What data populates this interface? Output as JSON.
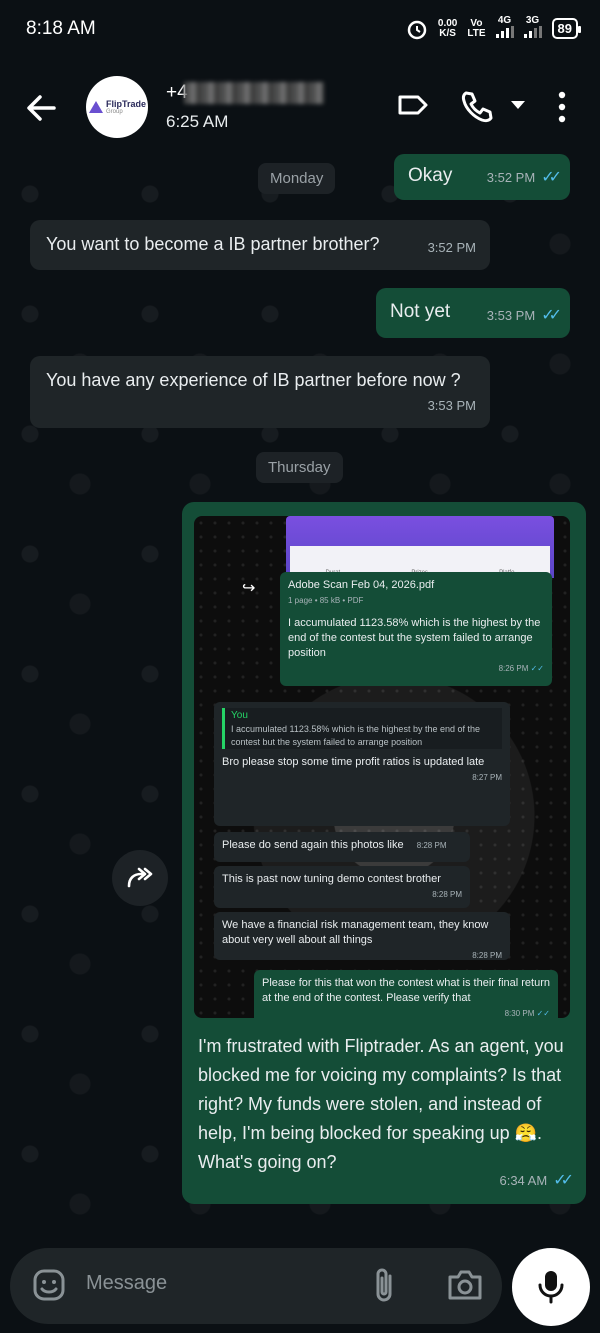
{
  "status_bar": {
    "time": "8:18 AM",
    "net_speed_value": "0.00",
    "net_speed_unit": "K/S",
    "volte_top": "Vo",
    "volte_bottom": "LTE",
    "sim1_type": "4G",
    "sim2_type": "3G",
    "battery": "89"
  },
  "header": {
    "contact_name_prefix": "+4",
    "contact_status": "6:25 AM",
    "avatar_logo_text": "FlipTrade",
    "avatar_logo_sub": "Group"
  },
  "chat": {
    "date_monday": "Monday",
    "date_thursday": "Thursday",
    "msg1_text": "Okay",
    "msg1_time": "3:52 PM",
    "msg2_text": "You want to become a IB partner brother?",
    "msg2_time": "3:52 PM",
    "msg3_text": "Not yet",
    "msg3_time": "3:53 PM",
    "msg4_text": "You have any experience of IB partner before now ?",
    "msg4_time": "3:53 PM",
    "image_caption": "I'm frustrated with Fliptrader. As an agent, you blocked me for voicing my complaints? Is that right? My funds were stolen, and instead of help, I'm being blocked for speaking up 😤. What's going on?",
    "image_caption_time": "6:34 AM"
  },
  "screenshot": {
    "sheet_col1": "Durat",
    "sheet_col2": "Prizes",
    "sheet_col3": "Platfo",
    "pdf_name": "Adobe Scan Feb 04, 2026.pdf",
    "pdf_meta": "1 page • 85 kB • PDF",
    "pdf_message": "I accumulated 1123.58% which is the highest by the end of the contest but the system failed to arrange position",
    "pdf_time": "8:26 PM",
    "reply_author": "You",
    "reply_quote": "I accumulated 1123.58% which is the highest by the end of the contest but the system failed to arrange position",
    "reply_text": "Bro please stop some time profit ratios is updated late",
    "reply_time": "8:27 PM",
    "m2_text": "Please do send again this photos like",
    "m2_time": "8:28 PM",
    "m3_text": "This is past now tuning demo contest brother",
    "m3_time": "8:28 PM",
    "m4_text": "We have a financial risk management team, they know about very well about all things",
    "m4_time": "8:28 PM",
    "m5_text": "Please for this that won the contest what is their final return at the end of the contest. Please verify that",
    "m5_time": "8:30 PM"
  },
  "input": {
    "placeholder": "Message"
  },
  "icons": {
    "back": "arrow-left-icon",
    "label": "label-icon",
    "call": "phone-icon",
    "dropdown": "chevron-down-icon",
    "menu": "more-vertical-icon",
    "forward": "forward-icon",
    "emoji": "emoji-icon",
    "attach": "paperclip-icon",
    "camera": "camera-icon",
    "mic": "mic-icon"
  },
  "colors": {
    "outgoing_bubble": "#144d37",
    "incoming_bubble": "#1f2528",
    "read_tick": "#53bdeb",
    "background": "#0b1014"
  }
}
